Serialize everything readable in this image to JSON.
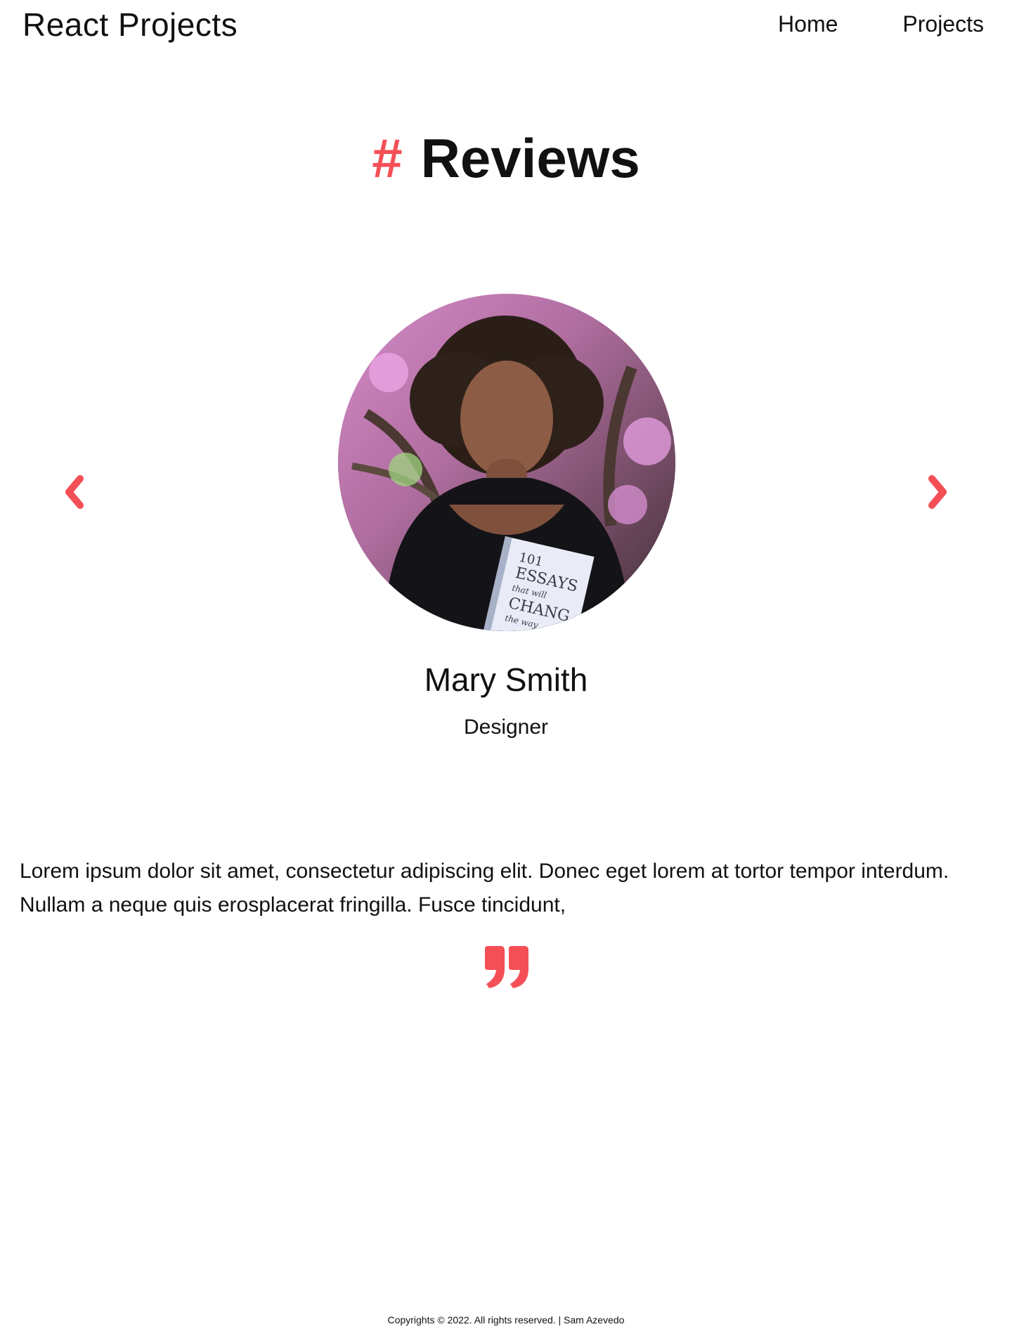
{
  "header": {
    "brand": "React Projects",
    "nav": [
      {
        "label": "Home"
      },
      {
        "label": "Projects"
      }
    ]
  },
  "section": {
    "hash": "#",
    "title": "Reviews"
  },
  "review": {
    "name": "Mary Smith",
    "role": "Designer",
    "text": "Lorem ipsum dolor sit amet, consectetur adipiscing elit. Donec eget lorem at tortor tempor interdum. Nullam a neque quis erosplacerat fringilla. Fusce tincidunt,",
    "image_alt": "Mary Smith",
    "book_text": {
      "line1": "101",
      "line2": "ESSAYS",
      "line3": "that will",
      "line4": "CHANG",
      "line5": "the way"
    }
  },
  "footer": {
    "text": "Copyrights © 2022. All rights reserved. | Sam Azevedo"
  },
  "colors": {
    "accent": "#f44f57",
    "text": "#111111",
    "background": "#ffffff"
  },
  "icons": {
    "prev": "chevron-left-icon",
    "next": "chevron-right-icon",
    "quote": "quote-icon"
  }
}
